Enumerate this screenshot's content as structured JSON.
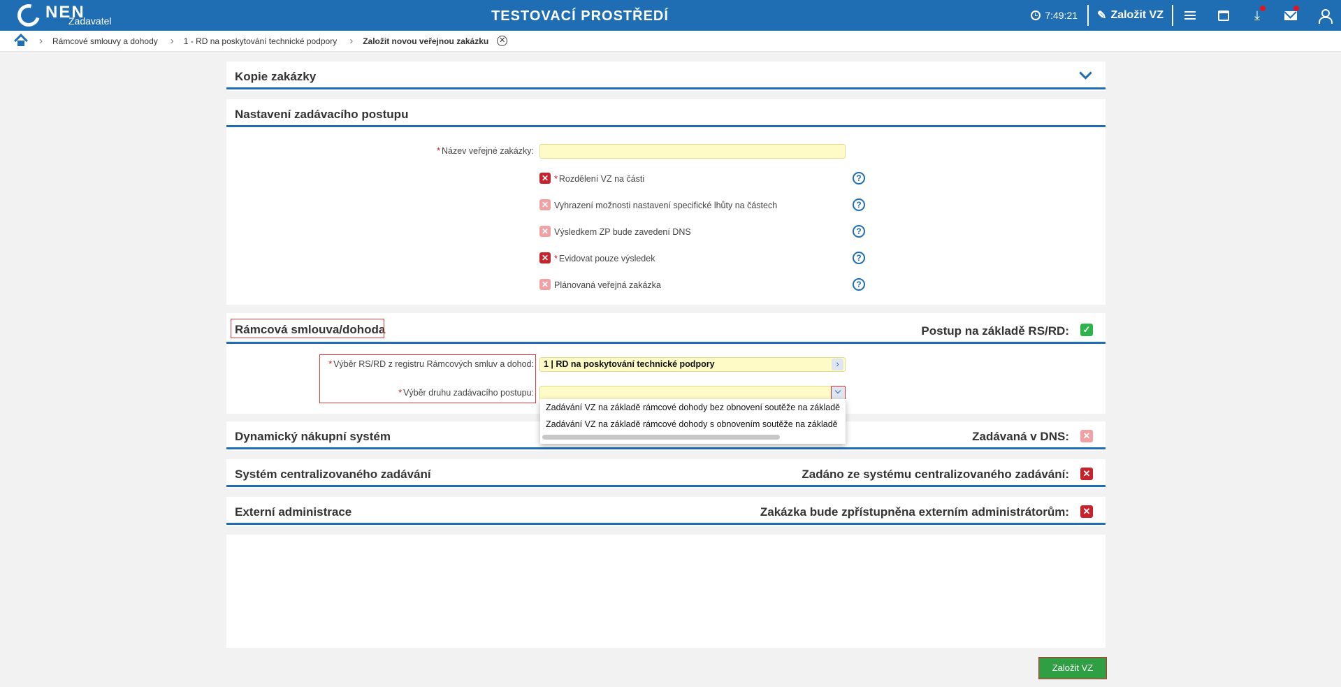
{
  "topbar": {
    "logo_text": "NEN",
    "logo_sub": "Zadavatel",
    "env_title": "TESTOVACÍ PROSTŘEDÍ",
    "time": "7:49:21",
    "create_label": "Založit VZ"
  },
  "breadcrumb": [
    "Rámcové smlouvy a dohody",
    "1 - RD na poskytování technické podpory",
    "Založit novou veřejnou zakázku"
  ],
  "sections": {
    "kopie": {
      "title": "Kopie zakázky"
    },
    "nastaveni": {
      "title": "Nastavení zadávacího postupu",
      "name_label": "Název veřejné zakázky:",
      "name_value": "",
      "checkboxes": [
        {
          "label": "Rozdělení VZ na části",
          "required": true
        },
        {
          "label": "Vyhrazení možnosti nastavení specifické lhůty na částech",
          "required": false
        },
        {
          "label": "Výsledkem ZP bude zavedení DNS",
          "required": false
        },
        {
          "label": "Evidovat pouze výsledek",
          "required": true
        },
        {
          "label": "Plánovaná veřejná zakázka",
          "required": false
        }
      ]
    },
    "ramcova": {
      "title": "Rámcová smlouva/dohoda",
      "right_label": "Postup na základě RS/RD:",
      "registry_label": "Výběr RS/RD z registru Rámcových smluv a dohod:",
      "registry_value": "1 | RD na poskytování technické podpory",
      "procedure_label": "Výběr druhu zadávacího postupu:",
      "procedure_value": "",
      "options": [
        "Zadávání VZ na základě rámcové dohody bez obnovení soutěže na základě",
        "Zadávání VZ na základě rámcové dohody s obnovením soutěže na základě"
      ]
    },
    "dns": {
      "title": "Dynamický nákupní systém",
      "right_label": "Zadávaná v DNS:"
    },
    "centralizovane": {
      "title": "Systém centralizovaného zadávání",
      "right_label": "Zadáno ze systému centralizovaného zadávání:"
    },
    "externi": {
      "title": "Externí administrace",
      "right_label": "Zakázka bude zpřístupněna externím administrátorům:"
    }
  },
  "footer": {
    "create_button": "Založit VZ"
  },
  "colors": {
    "brand": "#1f6eb4",
    "required": "#d0131b",
    "ok": "#2eb34b",
    "field": "#fffbc7"
  }
}
